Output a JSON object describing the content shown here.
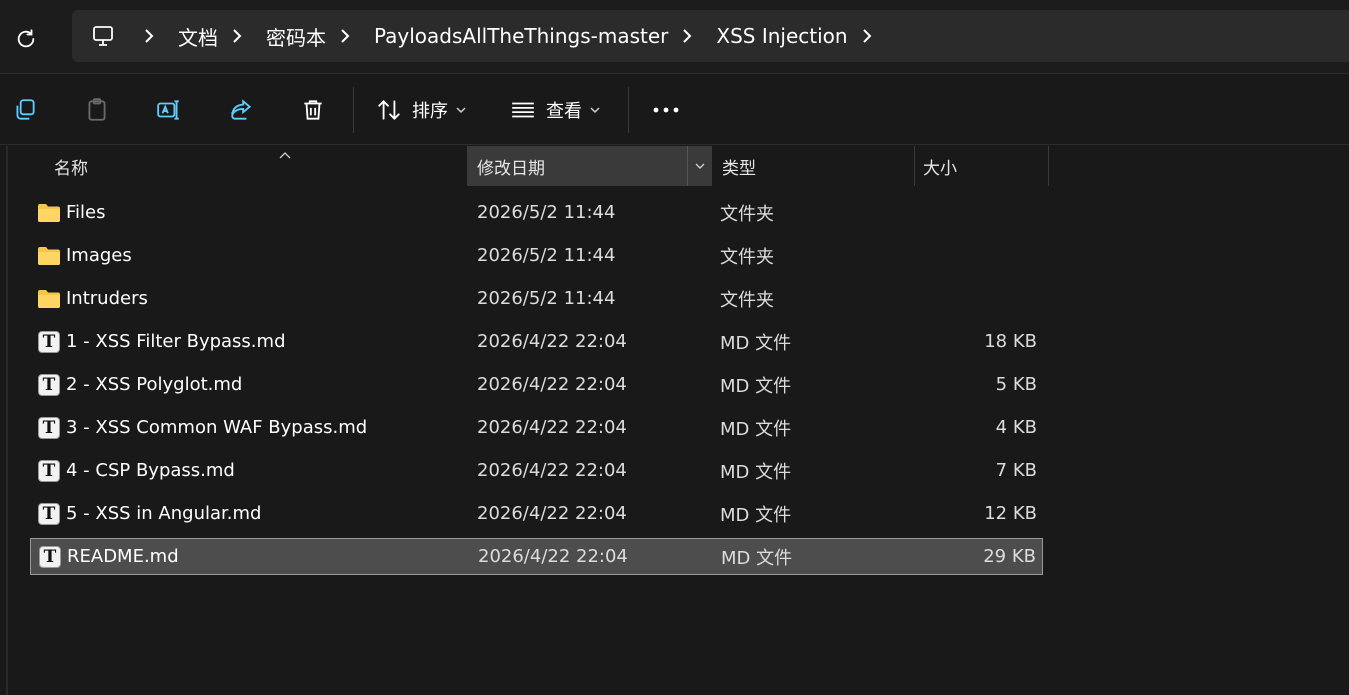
{
  "breadcrumb": [
    "文档",
    "密码本",
    "PayloadsAllTheThings-master",
    "XSS Injection"
  ],
  "toolbar": {
    "sort_label": "排序",
    "view_label": "查看"
  },
  "columns": {
    "name": "名称",
    "date": "修改日期",
    "type": "类型",
    "size": "大小"
  },
  "files": [
    {
      "icon": "folder-icon",
      "name": "Files",
      "date": "2026/5/2 11:44",
      "type": "文件夹",
      "size": ""
    },
    {
      "icon": "folder-icon",
      "name": "Images",
      "date": "2026/5/2 11:44",
      "type": "文件夹",
      "size": ""
    },
    {
      "icon": "folder-icon",
      "name": "Intruders",
      "date": "2026/5/2 11:44",
      "type": "文件夹",
      "size": ""
    },
    {
      "icon": "text-file-icon",
      "name": "1 - XSS Filter Bypass.md",
      "date": "2026/4/22 22:04",
      "type": "MD 文件",
      "size": "18 KB"
    },
    {
      "icon": "text-file-icon",
      "name": "2 - XSS Polyglot.md",
      "date": "2026/4/22 22:04",
      "type": "MD 文件",
      "size": "5 KB"
    },
    {
      "icon": "text-file-icon",
      "name": "3 - XSS Common WAF Bypass.md",
      "date": "2026/4/22 22:04",
      "type": "MD 文件",
      "size": "4 KB"
    },
    {
      "icon": "text-file-icon",
      "name": "4 - CSP Bypass.md",
      "date": "2026/4/22 22:04",
      "type": "MD 文件",
      "size": "7 KB"
    },
    {
      "icon": "text-file-icon",
      "name": "5 - XSS in Angular.md",
      "date": "2026/4/22 22:04",
      "type": "MD 文件",
      "size": "12 KB"
    },
    {
      "icon": "text-file-icon",
      "name": "README.md",
      "date": "2026/4/22 22:04",
      "type": "MD 文件",
      "size": "29 KB",
      "selected": true
    }
  ],
  "colors": {
    "accent": "#60cdff",
    "folder": "#f7c548",
    "selection": "#4d4d4d"
  }
}
